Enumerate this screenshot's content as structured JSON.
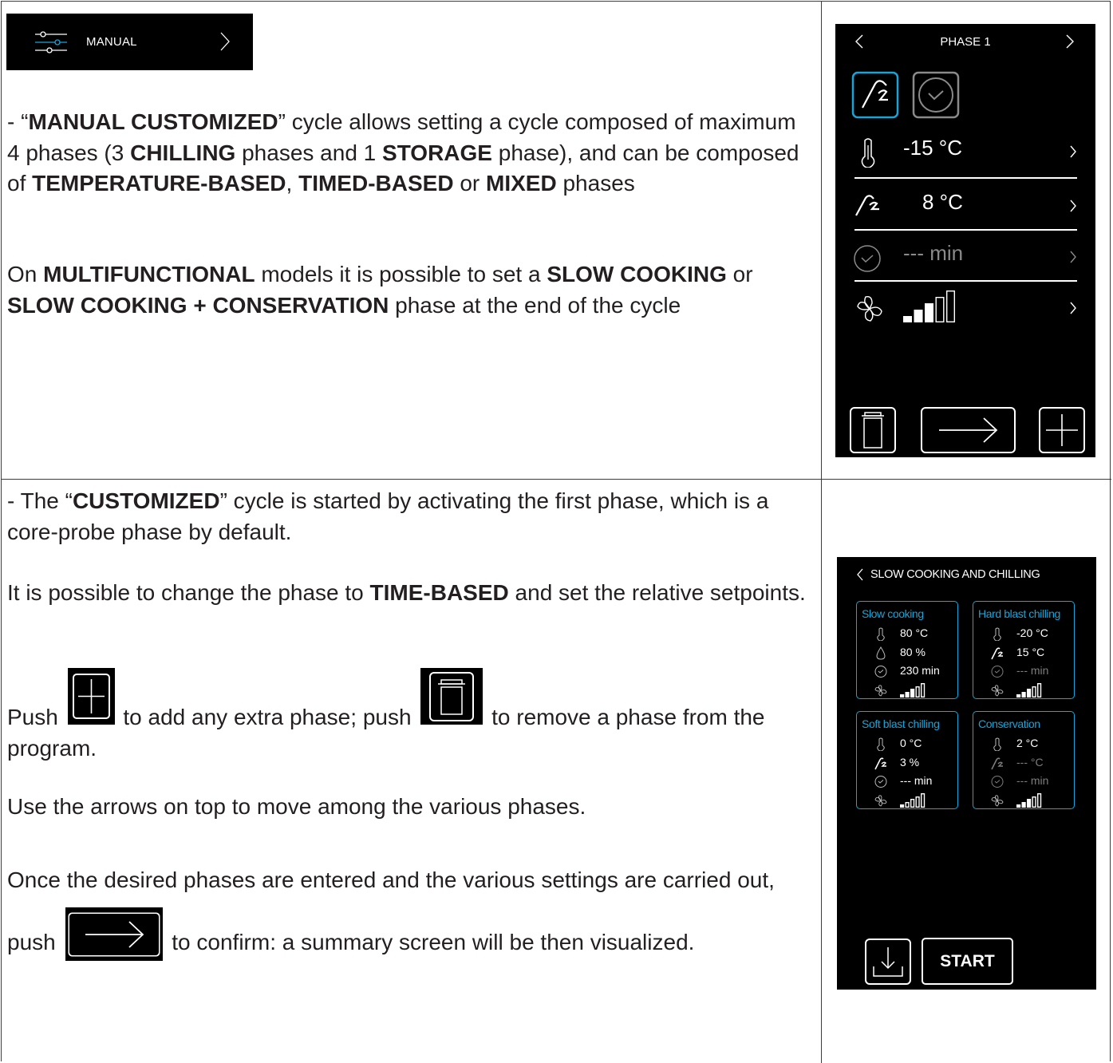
{
  "manual_button": {
    "label": "MANUAL"
  },
  "left": {
    "p1": [
      "- “",
      "MANUAL CUSTOMIZED",
      "” cycle allows setting a cycle composed of maximum 4 phases (3 ",
      "CHILLING",
      " phases and 1 ",
      "STORAGE",
      " phase), and can be composed of ",
      "TEMPERATURE-BASED",
      ", ",
      "TIMED-BASED",
      " or ",
      "MIXED",
      " phases"
    ],
    "p2": [
      "On ",
      "MULTIFUNCTIONAL",
      " models it is possible to set a ",
      "SLOW COOKING",
      " or ",
      "SLOW COOKING + CONSERVATION",
      " phase at the end of the cycle"
    ],
    "p3": [
      "- The “",
      "CUSTOMIZED",
      "” cycle is started by activating the first phase, which is a core-probe phase by default."
    ],
    "p4": [
      "It is possible to change the phase to ",
      "TIME-BASED",
      " and set the relative setpoints."
    ],
    "p5": [
      "Push",
      "to add any extra phase; push",
      "to remove a phase from the program."
    ],
    "p6": "Use the arrows on top to move among the various phases.",
    "p7": [
      "Once the desired phases are entered and the various settings are carried out, push",
      "to confirm: a summary screen will be then visualized."
    ]
  },
  "screen1": {
    "header": "PHASE 1",
    "rows": [
      {
        "icon": "thermometer-icon",
        "value": "-15 °C"
      },
      {
        "icon": "core-probe-icon",
        "value": "8 °C"
      },
      {
        "icon": "clock-icon",
        "value": "--- min"
      },
      {
        "icon": "fan-icon",
        "value": "",
        "fan_level": 3,
        "fan_max": 5
      }
    ]
  },
  "screen2": {
    "header": "SLOW COOKING AND CHILLING",
    "cards": [
      {
        "title": "Slow cooking",
        "lines": [
          {
            "icon": "thermometer-icon",
            "value": "80  °C",
            "dim": false
          },
          {
            "icon": "humidity-icon",
            "value": "80   %",
            "dim": false
          },
          {
            "icon": "clock-icon",
            "value": "230 min",
            "dim": false
          },
          {
            "icon": "fan-icon",
            "fan_level": 3
          }
        ]
      },
      {
        "title": "Hard blast chilling",
        "lines": [
          {
            "icon": "thermometer-icon",
            "value": "-20 °C",
            "dim": false
          },
          {
            "icon": "core-probe-icon",
            "value": "15 °C",
            "dim": false
          },
          {
            "icon": "clock-icon",
            "value": "---  min",
            "dim": true
          },
          {
            "icon": "fan-icon",
            "fan_level": 3
          }
        ]
      },
      {
        "title": "Soft blast chilling",
        "lines": [
          {
            "icon": "thermometer-icon",
            "value": "0  °C",
            "dim": false
          },
          {
            "icon": "core-probe-icon",
            "value": "3   %",
            "dim": false
          },
          {
            "icon": "clock-icon",
            "value": "---  min",
            "dim": false
          },
          {
            "icon": "fan-icon",
            "fan_level": 1
          }
        ]
      },
      {
        "title": "Conservation",
        "lines": [
          {
            "icon": "thermometer-icon",
            "value": "2 °C",
            "dim": false
          },
          {
            "icon": "core-probe-icon",
            "value": "--- °C",
            "dim": true
          },
          {
            "icon": "clock-icon",
            "value": "---  min",
            "dim": true
          },
          {
            "icon": "fan-icon",
            "fan_level": 3
          }
        ]
      }
    ],
    "start_label": "START"
  },
  "colors": {
    "accent": "#1aa3d8",
    "screen_bg": "#000000",
    "text": "#231f20",
    "dim": "#7d7d7d"
  }
}
